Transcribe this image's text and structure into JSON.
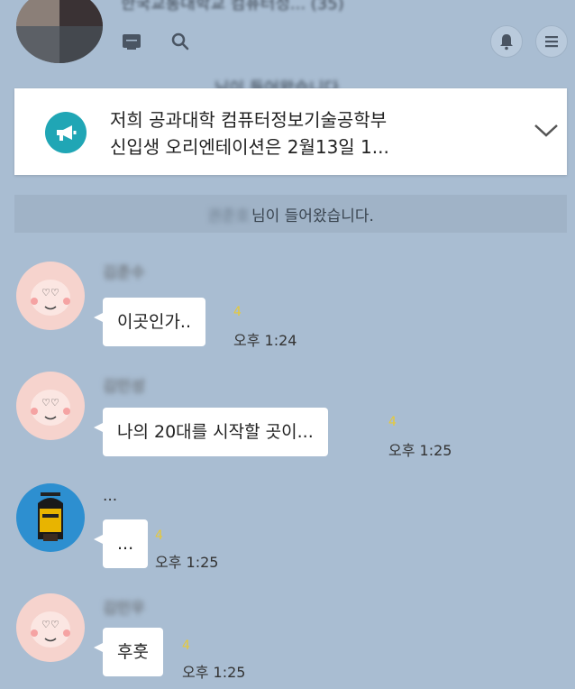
{
  "header": {
    "room_title": "한국교통대학교 컴퓨터정... (35)",
    "ghost_text": "님이 들어왔습니다"
  },
  "notice": {
    "line1": "저희 공과대학 컴퓨터정보기술공학부",
    "line2": "신입생 오리엔테이션은 2월13일 1..."
  },
  "system_message": {
    "name": "권준호",
    "text": "님이 들어왔습니다."
  },
  "messages": [
    {
      "sender": "김준수",
      "text": "이곳인가..",
      "unread": "4",
      "time": "오후 1:24"
    },
    {
      "sender": "김민성",
      "text": "나의 20대를 시작할 곳이...",
      "unread": "4",
      "time": "오후 1:25"
    },
    {
      "sender": "...",
      "text": "...",
      "unread": "4",
      "time": "오후 1:25"
    },
    {
      "sender": "김민우",
      "text": "후훗",
      "unread": "4",
      "time": "오후 1:25"
    }
  ],
  "colors": {
    "background": "#a9bdd2",
    "notice_icon": "#20a6b5",
    "unread_count": "#e6c93a"
  },
  "icons": [
    "gallery-icon",
    "search-icon",
    "bell-icon",
    "menu-icon",
    "megaphone-icon",
    "chevron-down-icon"
  ]
}
